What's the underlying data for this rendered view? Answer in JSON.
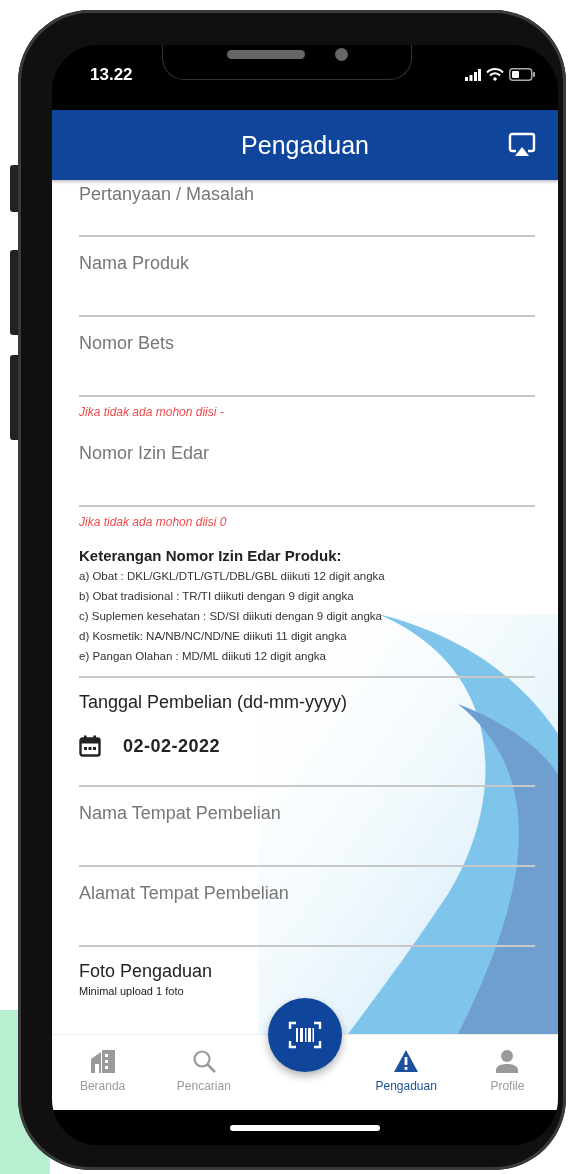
{
  "status_bar": {
    "time": "13.22"
  },
  "app_bar": {
    "title": "Pengaduan"
  },
  "form": [
    {
      "kind": "field",
      "placeholder": "Pertanyaan / Masalah"
    },
    {
      "kind": "field",
      "placeholder": "Nama Produk"
    },
    {
      "kind": "field",
      "placeholder": "Nomor Bets"
    },
    {
      "kind": "hint",
      "text": "Jika tidak ada mohon diisi -"
    },
    {
      "kind": "field",
      "placeholder": "Nomor Izin Edar"
    },
    {
      "kind": "hint",
      "text": "Jika tidak ada mohon diisi 0"
    },
    {
      "kind": "info",
      "title": "Keterangan Nomor Izin Edar Produk:",
      "lines": [
        "a) Obat : DKL/GKL/DTL/GTL/DBL/GBL diikuti 12 digit angka",
        "b) Obat tradisional : TR/TI diikuti dengan 9 digit angka",
        "c) Suplemen kesehatan : SD/SI diikuti dengan 9 digit angka",
        "d) Kosmetik: NA/NB/NC/ND/NE diikuti 11 digit angka",
        "e) Pangan Olahan : MD/ML diikuti 12 digit angka"
      ]
    },
    {
      "kind": "date",
      "label": "Tanggal Pembelian (dd-mm-yyyy)",
      "value": "02-02-2022"
    },
    {
      "kind": "field",
      "placeholder": "Nama Tempat Pembelian"
    },
    {
      "kind": "field",
      "placeholder": "Alamat Tempat Pembelian"
    },
    {
      "kind": "photo",
      "label": "Foto Pengaduan",
      "note": "Minimal upload 1 foto"
    }
  ],
  "bottom_nav": {
    "items": [
      {
        "label": "Beranda",
        "selected": false
      },
      {
        "label": "Pencarian",
        "selected": false
      },
      {
        "label": "Pengaduan",
        "selected": true
      },
      {
        "label": "Profile",
        "selected": false
      }
    ]
  }
}
